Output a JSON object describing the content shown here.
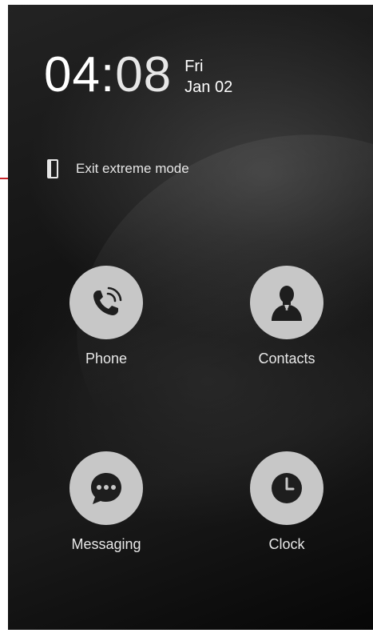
{
  "lockscreen": {
    "time_hours": "04",
    "time_sep": ":",
    "time_minutes": "08",
    "day": "Fri",
    "date": "Jan 02"
  },
  "extreme_mode": {
    "label": "Exit extreme mode",
    "icon": "phone-outline-icon",
    "indicator_color": "#c8252b"
  },
  "apps": [
    {
      "label": "Phone",
      "icon": "phone-call-icon"
    },
    {
      "label": "Contacts",
      "icon": "person-silhouette-icon"
    },
    {
      "label": "Messaging",
      "icon": "chat-bubble-icon"
    },
    {
      "label": "Clock",
      "icon": "clock-icon"
    }
  ],
  "colors": {
    "background": "#111111",
    "icon_circle": "#c7c7c7",
    "icon_glyph": "#1e1e1e",
    "text": "#ffffff"
  }
}
